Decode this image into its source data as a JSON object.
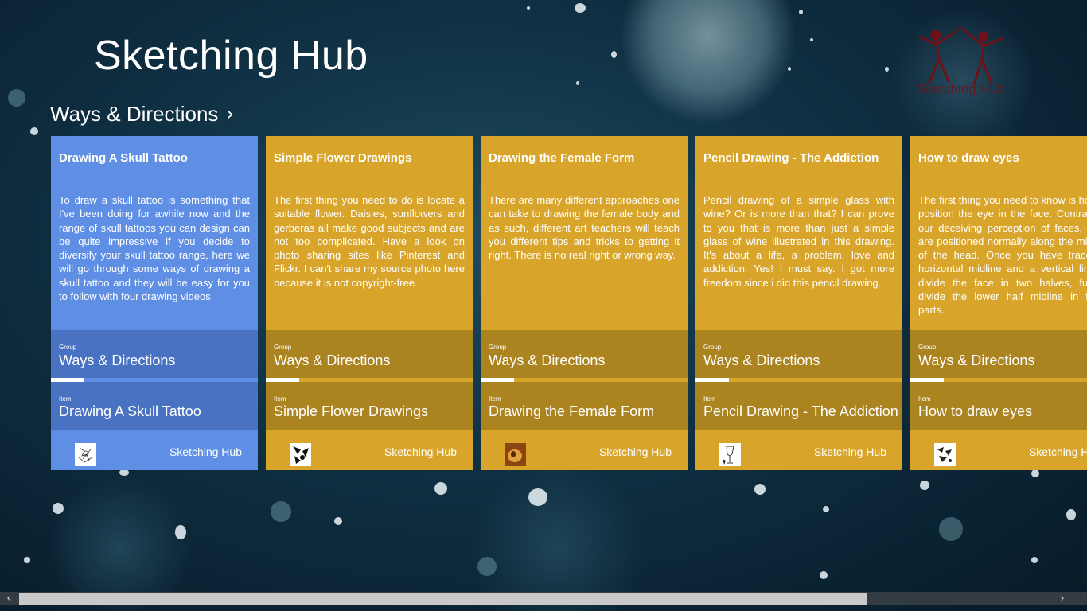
{
  "app": {
    "title": "Sketching Hub",
    "logo_text": "Sketching Hub"
  },
  "section": {
    "title": "Ways & Directions",
    "chevron": "›"
  },
  "cards": [
    {
      "title": "Drawing A Skull Tattoo",
      "body": "To draw a skull tattoo is something that I've been doing for awhile now and the range of skull tattoos you can design can be quite impressive if you decide to diversify your skull tattoo range, here we will go through some ways of drawing a skull tattoo and they will be easy for you to follow with four drawing videos.",
      "group_label": "Group",
      "group_value": "Ways & Directions",
      "item_label": "Item",
      "item_value": "Drawing A Skull Tattoo",
      "source": "Sketching Hub",
      "thumb": "skull-sketch-thumbnail",
      "color": "#5f8fe5"
    },
    {
      "title": "Simple Flower Drawings",
      "body": "The first thing you need to do is locate a suitable flower. Daisies, sunflowers and gerberas all make good subjects and are not too complicated. Have a look on photo sharing sites like Pinterest and Flickr. I can't share my source photo here because it is not copyright-free.",
      "group_label": "Group",
      "group_value": "Ways & Directions",
      "item_label": "Item",
      "item_value": "Simple Flower Drawings",
      "source": "Sketching Hub",
      "thumb": "flower-sketch-thumbnail",
      "color": "#d8a52a"
    },
    {
      "title": "Drawing the Female Form",
      "body": "There are many different approaches one can take to drawing the female body and as such, different art teachers will teach you different tips and tricks to getting it right. There is no real right or wrong way.",
      "group_label": "Group",
      "group_value": "Ways & Directions",
      "item_label": "Item",
      "item_value": "Drawing the Female Form",
      "source": "Sketching Hub",
      "thumb": "female-form-thumbnail",
      "color": "#d8a52a"
    },
    {
      "title": "Pencil Drawing - The Addiction",
      "body": "Pencil drawing of a simple glass with wine? Or is more than that? I can prove to you that is more than just a simple glass of wine illustrated in this drawing. It's about a life, a problem, love and addiction. Yes! I must say. I got more freedom since i did this pencil drawing.",
      "group_label": "Group",
      "group_value": "Ways & Directions",
      "item_label": "Item",
      "item_value": "Pencil Drawing - The Addiction",
      "source": "Sketching Hub",
      "thumb": "wine-glass-sketch-thumbnail",
      "color": "#d8a52a"
    },
    {
      "title": "How to draw eyes",
      "body": "The first thing you need to know is how to position the eye in the face. Contrary to our deceiving perception of faces, eyes are positioned normally along the midline of the head. Once you have traced a horizontal midline and a vertical line to divide the face in two halves, further divide the lower half midline in three parts.",
      "group_label": "Group",
      "group_value": "Ways & Directions",
      "item_label": "Item",
      "item_value": "How to draw eyes",
      "source": "Sketching Hub",
      "thumb": "eye-sketch-thumbnail",
      "color": "#d8a52a"
    }
  ],
  "scrollbar": {
    "left_arrow": "‹",
    "right_arrow": "›",
    "position": 0.0
  }
}
